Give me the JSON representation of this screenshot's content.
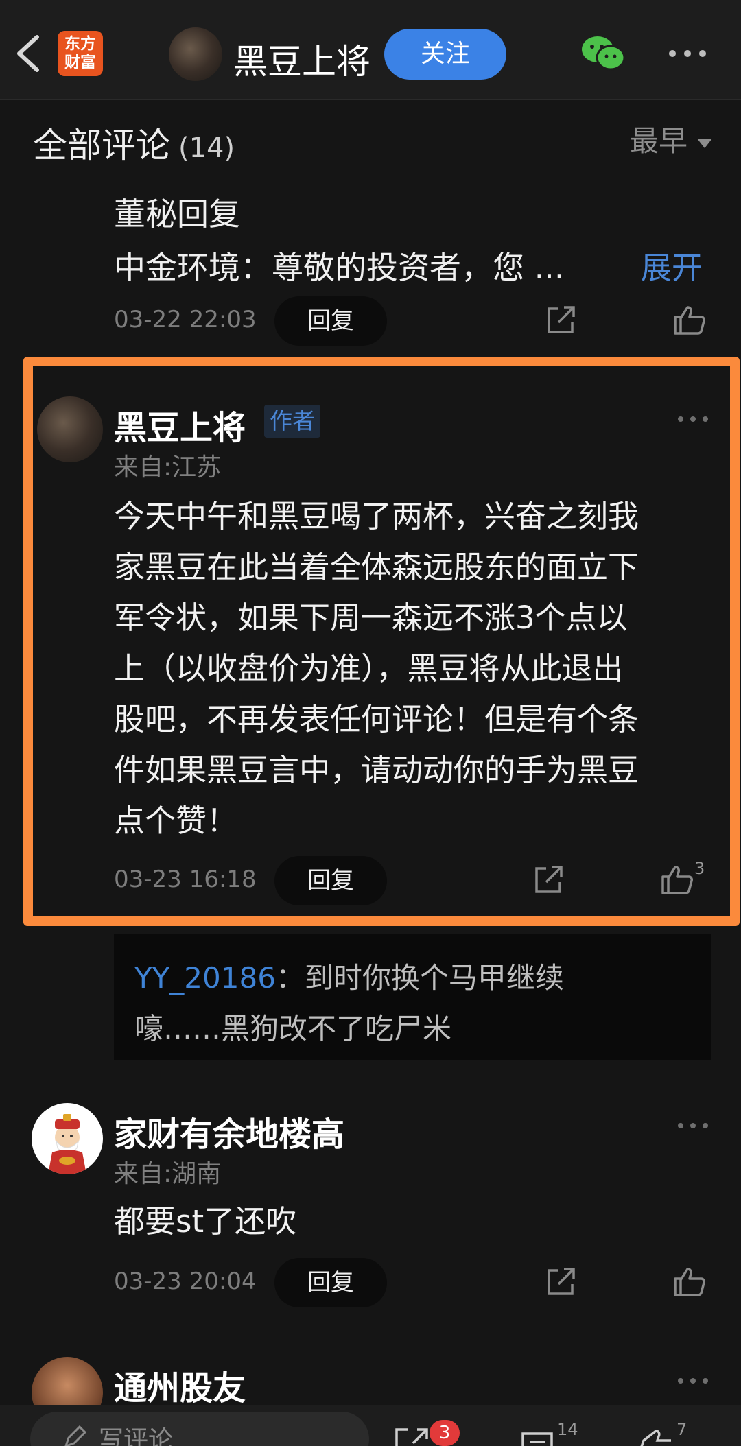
{
  "header": {
    "logo_text": [
      "东方",
      "财富"
    ],
    "user_name": "黑豆上将",
    "follow_label": "关注"
  },
  "section": {
    "title": "全部评论",
    "count": "(14)",
    "sort_label": "最早"
  },
  "comments": [
    {
      "reply_title": "董秘回复",
      "reply_preview": "中金环境：尊敬的投资者，您 ...",
      "expand_label": "展开",
      "time": "03-22 22:03",
      "reply_label": "回复"
    },
    {
      "name": "黑豆上将",
      "badge": "作者",
      "location": "来自:江苏",
      "lines": [
        "今天中午和黑豆喝了两杯，兴奋之刻我",
        "家黑豆在此当着全体森远股东的面立下",
        "军令状，如果下周一森远不涨3个点以",
        "上（以收盘价为准），黑豆将从此退出",
        "股吧，不再发表任何评论！但是有个条",
        "件如果黑豆言中，请动动你的手为黑豆",
        "点个赞！"
      ],
      "time": "03-23 16:18",
      "reply_label": "回复",
      "like_count": "3",
      "sub_reply": {
        "user": "YY_20186",
        "text_line1": "：到时你换个马甲继续",
        "text_line2": "嚎……黑狗改不了吃尸米"
      }
    },
    {
      "name": "家财有余地楼高",
      "location": "来自:湖南",
      "text": "都要st了还吹",
      "time": "03-23 20:04",
      "reply_label": "回复"
    },
    {
      "name": "通州股友"
    }
  ],
  "bottom": {
    "input_placeholder": "写评论",
    "share_badge": "3",
    "comment_count": "14",
    "like_count": "7"
  },
  "colors": {
    "highlight": "#fb8a3c",
    "accent_blue": "#3b82e6",
    "link_blue": "#4a86d6",
    "wechat_green": "#4cc14a",
    "badge_red": "#e23a3a"
  }
}
